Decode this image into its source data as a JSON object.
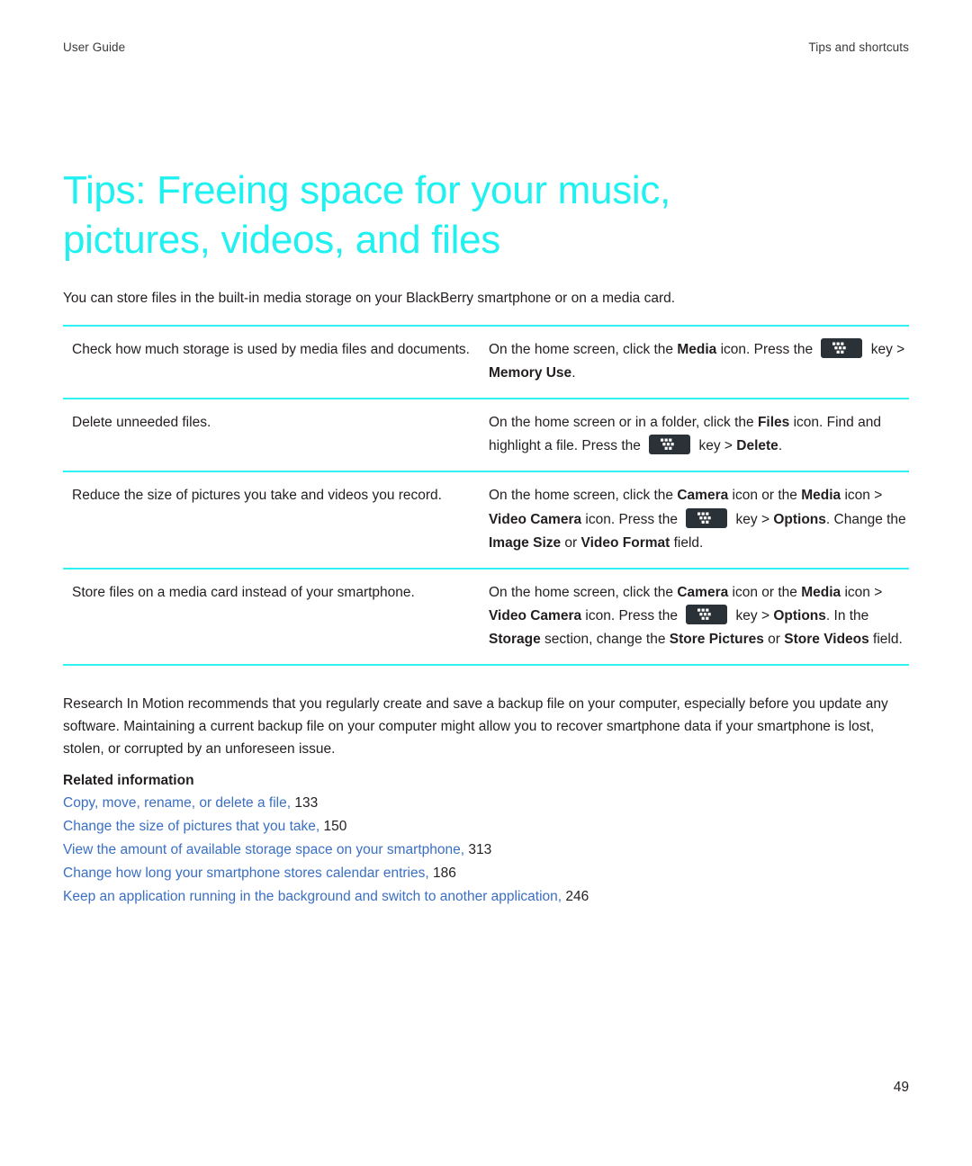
{
  "header": {
    "left": "User Guide",
    "right": "Tips and shortcuts"
  },
  "title": "Tips: Freeing space for your music, pictures, videos, and files",
  "intro": "You can store files in the built-in media storage on your BlackBerry smartphone or on a media card.",
  "colors": {
    "title_cyan": "#1ff0f0",
    "rule_cyan": "#2ff2f2",
    "link_blue": "#3a6fc4",
    "body_text": "#231f20",
    "bb_key_bg": "#2a3137"
  },
  "table": {
    "rows": [
      {
        "task": "Check how much storage is used by media files and documents.",
        "action": {
          "seg1": "On the home screen, click the ",
          "b1": "Media",
          "seg2": " icon. Press the ",
          "icon": "blackberry-menu-key-icon",
          "seg3": " key > ",
          "b2": "Memory Use",
          "seg4": "."
        }
      },
      {
        "task": "Delete unneeded files.",
        "action": {
          "seg1": "On the home screen or in a folder, click the ",
          "b1": "Files",
          "seg2": " icon. Find and highlight a file. Press the ",
          "icon": "blackberry-menu-key-icon",
          "seg3": " key > ",
          "b2": "Delete",
          "seg4": "."
        }
      },
      {
        "task": "Reduce the size of pictures you take and videos you record.",
        "action": {
          "seg1": "On the home screen, click the ",
          "b1": "Camera",
          "seg2": " icon or the ",
          "b2": "Media",
          "seg3": " icon > ",
          "b3": "Video Camera",
          "seg4": " icon. Press the ",
          "icon": "blackberry-menu-key-icon",
          "seg5": " key > ",
          "b4": "Options",
          "seg6": ". Change the ",
          "b5": "Image Size",
          "seg7": " or ",
          "b6": "Video Format",
          "seg8": " field."
        }
      },
      {
        "task": "Store files on a media card instead of your smartphone.",
        "action": {
          "seg1": "On the home screen, click the ",
          "b1": "Camera",
          "seg2": " icon or the ",
          "b2": "Media",
          "seg3": " icon > ",
          "b3": "Video Camera",
          "seg4": " icon. Press the ",
          "icon": "blackberry-menu-key-icon",
          "seg5": " key > ",
          "b4": "Options",
          "seg6": ". In the ",
          "b5": "Storage",
          "seg7": " section, change the ",
          "b6": "Store Pictures",
          "seg8": " or ",
          "b7": "Store Videos",
          "seg9": " field."
        }
      }
    ]
  },
  "closing": "Research In Motion recommends that you regularly create and save a backup file on your computer, especially before you update any software. Maintaining a current backup file on your computer might allow you to recover smartphone data if your smartphone is lost, stolen, or corrupted by an unforeseen issue.",
  "related": {
    "heading": "Related information",
    "links": [
      {
        "text": "Copy, move, rename, or delete a file,",
        "page": "133"
      },
      {
        "text": "Change the size of pictures that you take,",
        "page": "150"
      },
      {
        "text": "View the amount of available storage space on your smartphone,",
        "page": "313"
      },
      {
        "text": "Change how long your smartphone stores calendar entries,",
        "page": "186"
      },
      {
        "text": "Keep an application running in the background and switch to another application,",
        "page": "246"
      }
    ]
  },
  "page_number": "49"
}
